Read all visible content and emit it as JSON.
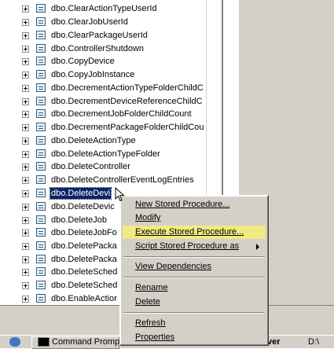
{
  "tree": {
    "items": [
      {
        "label": "dbo.ClearActionTypeUserId"
      },
      {
        "label": "dbo.ClearJobUserId"
      },
      {
        "label": "dbo.ClearPackageUserId"
      },
      {
        "label": "dbo.ControllerShutdown"
      },
      {
        "label": "dbo.CopyDevice"
      },
      {
        "label": "dbo.CopyJobInstance"
      },
      {
        "label": "dbo.DecrementActionTypeFolderChildC"
      },
      {
        "label": "dbo.DecrementDeviceReferenceChildC"
      },
      {
        "label": "dbo.DecrementJobFolderChildCount"
      },
      {
        "label": "dbo.DecrementPackageFolderChildCou"
      },
      {
        "label": "dbo.DeleteActionType"
      },
      {
        "label": "dbo.DeleteActionTypeFolder"
      },
      {
        "label": "dbo.DeleteController"
      },
      {
        "label": "dbo.DeleteControllerEventLogEntries"
      },
      {
        "label": "dbo.DeleteDevi"
      },
      {
        "label": "dbo.DeleteDevic"
      },
      {
        "label": "dbo.DeleteJob"
      },
      {
        "label": "dbo.DeleteJobFo"
      },
      {
        "label": "dbo.DeletePacka"
      },
      {
        "label": "dbo.DeletePacka"
      },
      {
        "label": "dbo.DeleteSched"
      },
      {
        "label": "dbo.DeleteSched"
      },
      {
        "label": "dbo.EnableActior"
      }
    ],
    "selected_index": 14
  },
  "context_menu": {
    "items": [
      {
        "label": "New Stored Procedure...",
        "type": "item"
      },
      {
        "label": "Modify",
        "type": "item"
      },
      {
        "label": "Execute Stored Procedure...",
        "type": "item",
        "highlighted": true
      },
      {
        "label": "Script Stored Procedure as",
        "type": "submenu"
      },
      {
        "label": "View Dependencies",
        "type": "item"
      },
      {
        "label": "Rename",
        "type": "item"
      },
      {
        "label": "Delete",
        "type": "item"
      },
      {
        "label": "Refresh",
        "type": "item"
      },
      {
        "label": "Properties",
        "type": "item"
      }
    ]
  },
  "taskbar": {
    "command_prompt_label": "Command Promp",
    "server_label": "ver",
    "drive_label": "D:\\"
  },
  "colors": {
    "selection": "#0a246a",
    "menu_highlight": "#f2ea82",
    "menu_background": "#d4d0c8"
  }
}
